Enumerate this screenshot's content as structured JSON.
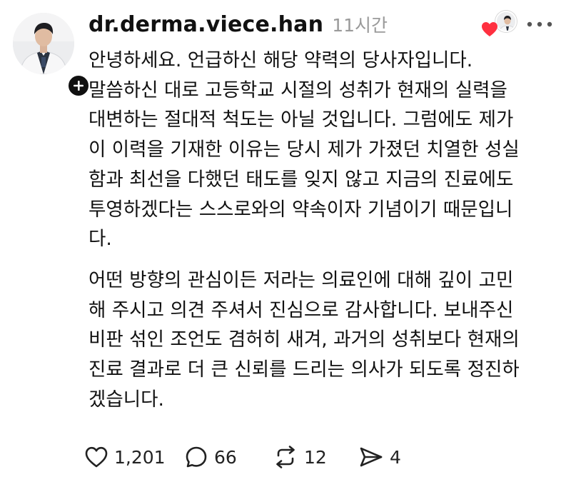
{
  "post": {
    "username": "dr.derma.viece.han",
    "timestamp": "11시간",
    "paragraph_1": "안녕하세요. 언급하신 해당 약력의 당사자입니다.\n말씀하신 대로 고등학교 시절의 성취가 현재의 실력을\n대변하는 절대적 척도는 아닐 것입니다. 그럼에도 제가\n이 이력을 기재한 이유는 당시 제가 가졌던 치열한 성실\n함과 최선을 다했던 태도를 잊지 않고 지금의 진료에도\n투영하겠다는 스스로와의 약속이자 기념이기 때문입니\n다.",
    "paragraph_2": "어떤 방향의 관심이든 저라는 의료인에 대해 깊이 고민\n해 주시고 의견 주셔서 진심으로 감사합니다. 보내주신\n비판 섞인 조언도 겸허히 새겨, 과거의 성취보다 현재의\n진료 결과로 더 큰 신뢰를 드리는 의사가 되도록 정진하\n겠습니다."
  },
  "actions": {
    "likes": "1,201",
    "comments": "66",
    "reposts": "12",
    "shares": "4"
  },
  "icons": {
    "avatar": "profile-photo",
    "follow": "plus-icon",
    "liked_badge": "heart-icon",
    "more": "more-dots-icon",
    "like": "heart-outline-icon",
    "comment": "speech-bubble-icon",
    "repost": "repost-icon",
    "share": "paper-plane-icon"
  },
  "colors": {
    "liked_heart": "#ff3040",
    "text": "#111111",
    "muted": "#9a9a9a"
  }
}
